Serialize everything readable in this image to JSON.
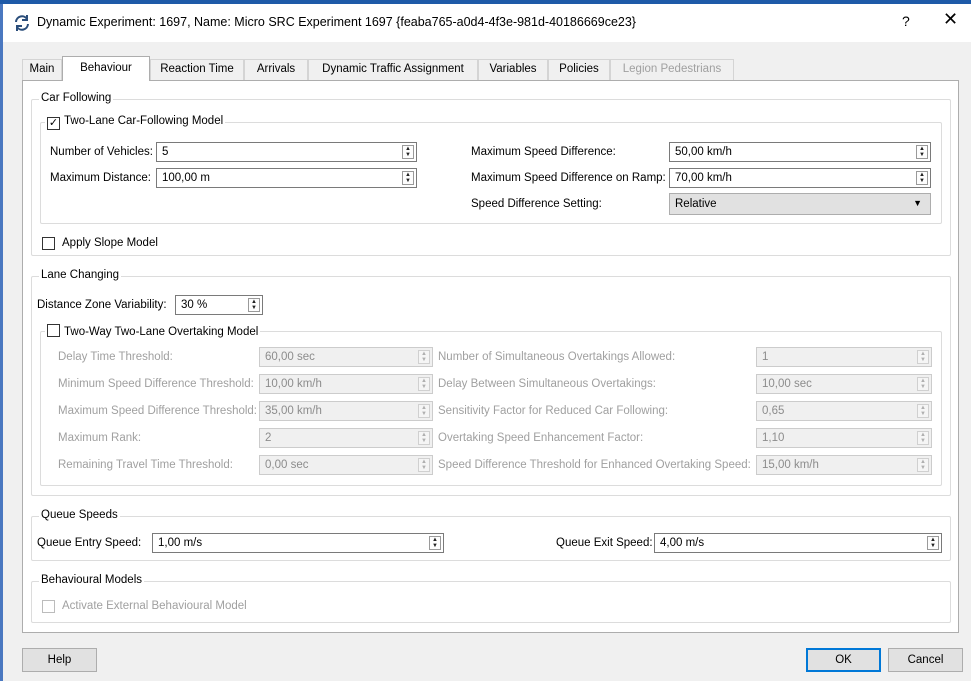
{
  "window": {
    "title": "Dynamic Experiment: 1697, Name: Micro SRC Experiment 1697 {feaba765-a0d4-4f3e-981d-40186669ce23}",
    "help_label": "?",
    "close_label": "✕"
  },
  "tabs": [
    {
      "label": "Main"
    },
    {
      "label": "Behaviour"
    },
    {
      "label": "Reaction Time"
    },
    {
      "label": "Arrivals"
    },
    {
      "label": "Dynamic Traffic Assignment"
    },
    {
      "label": "Variables"
    },
    {
      "label": "Policies"
    },
    {
      "label": "Legion Pedestrians"
    }
  ],
  "car_following": {
    "title": "Car Following",
    "two_lane": {
      "label": "Two-Lane Car-Following Model",
      "checked": "✓",
      "num_vehicles_label": "Number of Vehicles:",
      "num_vehicles": "5",
      "max_distance_label": "Maximum Distance:",
      "max_distance": "100,00 m",
      "max_speed_diff_label": "Maximum Speed Difference:",
      "max_speed_diff": "50,00 km/h",
      "max_speed_diff_ramp_label": "Maximum Speed Difference on Ramp:",
      "max_speed_diff_ramp": "70,00 km/h",
      "speed_diff_setting_label": "Speed Difference Setting:",
      "speed_diff_setting": "Relative"
    },
    "slope_label": "Apply Slope Model"
  },
  "lane_changing": {
    "title": "Lane Changing",
    "dzv_label": "Distance Zone Variability:",
    "dzv_value": "30 %",
    "overtaking": {
      "label": "Two-Way Two-Lane Overtaking Model",
      "left": [
        {
          "label": "Delay Time Threshold:",
          "value": "60,00 sec"
        },
        {
          "label": "Minimum Speed Difference Threshold:",
          "value": "10,00 km/h"
        },
        {
          "label": "Maximum Speed Difference Threshold:",
          "value": "35,00 km/h"
        },
        {
          "label": "Maximum Rank:",
          "value": "2"
        },
        {
          "label": "Remaining Travel Time Threshold:",
          "value": "0,00 sec"
        }
      ],
      "right": [
        {
          "label": "Number of Simultaneous Overtakings Allowed:",
          "value": "1"
        },
        {
          "label": "Delay Between Simultaneous Overtakings:",
          "value": "10,00 sec"
        },
        {
          "label": "Sensitivity Factor for Reduced Car Following:",
          "value": "0,65"
        },
        {
          "label": "Overtaking Speed Enhancement Factor:",
          "value": "1,10"
        },
        {
          "label": "Speed Difference Threshold for Enhanced Overtaking Speed:",
          "value": "15,00 km/h"
        }
      ]
    }
  },
  "queue": {
    "title": "Queue Speeds",
    "entry_label": "Queue Entry Speed:",
    "entry_value": "1,00 m/s",
    "exit_label": "Queue Exit Speed:",
    "exit_value": "4,00 m/s"
  },
  "behavioural": {
    "title": "Behavioural Models",
    "activate_label": "Activate External Behavioural Model"
  },
  "buttons": {
    "help": "Help",
    "ok": "OK",
    "cancel": "Cancel"
  },
  "icons": {
    "spin_up": "▲",
    "spin_down": "▼",
    "combo_arrow": "▼"
  }
}
